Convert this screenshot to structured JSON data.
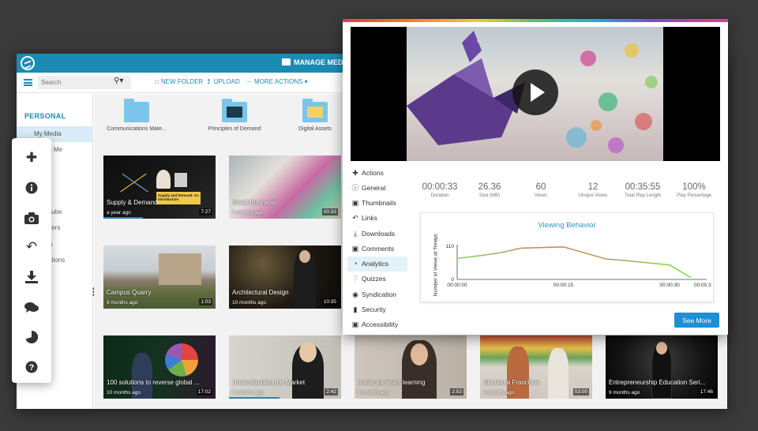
{
  "header": {
    "title": "MANAGE MEDI"
  },
  "toolbar": {
    "search_placeholder": "Search",
    "new_folder": "NEW FOLDER",
    "upload": "UPLOAD",
    "more_actions": "MORE ACTIONS"
  },
  "sidebar": {
    "section": "PERSONAL",
    "items": [
      {
        "label": "My Media"
      },
      {
        "label": "d With Me"
      },
      {
        "label": "d"
      },
      {
        "label": "orlseTube"
      },
      {
        "label": "d Folders"
      },
      {
        "label": "ennels"
      },
      {
        "label": "Collections"
      }
    ]
  },
  "folders": [
    {
      "label": "Communications Mate..."
    },
    {
      "label": "Principles of Demand"
    },
    {
      "label": "Digital Assets"
    }
  ],
  "videos": [
    {
      "title": "Supply & Demand",
      "date": "a year ago",
      "duration": "7:27",
      "overlay": "Supply and Demand: An Introduction",
      "progress": 0.35
    },
    {
      "title": "Small Business",
      "date": "9 months ago",
      "duration": "00:33",
      "progress": 0.0
    },
    {
      "title": "Campus Quarry",
      "date": "9 months ago",
      "duration": "1:03",
      "progress": 0.0
    },
    {
      "title": "Architectural Design",
      "date": "10 months ago",
      "duration": "10:35",
      "progress": 0.0
    },
    {
      "title": "100 solutions to reverse global ...",
      "date": "10 months ago",
      "duration": "17:02",
      "progress": 0.0
    },
    {
      "title": "Understanding the Market",
      "date": "9 months ago",
      "duration": "2:42",
      "progress": 0.45
    },
    {
      "title": "Inside the team learning",
      "date": "9 months ago",
      "duration": "2:53",
      "progress": 0.0
    },
    {
      "title": "Starting a Franchise",
      "date": "4 months ago",
      "duration": "53:00",
      "progress": 0.0
    },
    {
      "title": "Entrepreneurship Education Seri...",
      "date": "9 months ago",
      "duration": "17:46",
      "progress": 0.0
    }
  ],
  "float_tools": [
    {
      "icon": "plus-icon"
    },
    {
      "icon": "info-icon"
    },
    {
      "icon": "camera-icon"
    },
    {
      "icon": "reply-icon"
    },
    {
      "icon": "download-icon"
    },
    {
      "icon": "comments-icon"
    },
    {
      "icon": "pie-chart-icon"
    },
    {
      "icon": "help-icon"
    }
  ],
  "panel": {
    "menu": [
      {
        "label": "Actions",
        "icon": "plus-icon"
      },
      {
        "label": "General",
        "icon": "info-icon"
      },
      {
        "label": "Thumbnails",
        "icon": "camera-icon"
      },
      {
        "label": "Links",
        "icon": "reply-icon"
      },
      {
        "label": "Downloads",
        "icon": "download-icon"
      },
      {
        "label": "Comments",
        "icon": "comments-icon"
      },
      {
        "label": "Analytics",
        "icon": "pie-chart-icon"
      },
      {
        "label": "Quizzes",
        "icon": "help-icon"
      },
      {
        "label": "Syndication",
        "icon": "rss-icon"
      },
      {
        "label": "Security",
        "icon": "lock-icon"
      },
      {
        "label": "Accessibility",
        "icon": "cc-icon"
      }
    ],
    "stats": [
      {
        "value": "00:00:33",
        "label": "Duration"
      },
      {
        "value": "26.36",
        "label": "Size (MB)"
      },
      {
        "value": "60",
        "label": "Views"
      },
      {
        "value": "12",
        "label": "Unique Views"
      },
      {
        "value": "00:35:55",
        "label": "Total Play Length"
      },
      {
        "value": "100%",
        "label": "Play Percentage"
      }
    ],
    "see_more": "See More"
  },
  "chart_data": {
    "type": "line",
    "title": "Viewing Behavior",
    "ylabel": "Number of Views at Timepc",
    "xlabel": "",
    "x_ticks": [
      "00:00:00",
      "00:00:15",
      "00:00:30",
      "00:00:3"
    ],
    "y_ticks": [
      "0",
      "110"
    ],
    "ylim": [
      0,
      110
    ],
    "x_seconds_lim": [
      0,
      33
    ],
    "x": [
      0,
      3,
      6,
      9,
      12,
      15,
      18,
      21,
      24,
      27,
      30,
      33
    ],
    "y": [
      70,
      78,
      88,
      104,
      106,
      108,
      88,
      68,
      62,
      55,
      48,
      6
    ],
    "grid": false,
    "line_gradient_colors": [
      "#8fd36b",
      "#e07a6b",
      "#7be04a"
    ]
  }
}
